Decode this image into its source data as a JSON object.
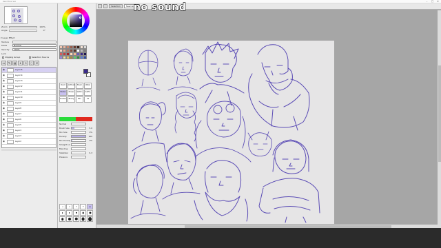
{
  "caption": "no sound",
  "titlebar": {
    "title": "PaintTool SAI"
  },
  "navigator": {
    "zoom_label": "Zoom",
    "zoom_value": "100%",
    "angle_label": "Angle",
    "angle_value": "0°"
  },
  "layer_panel": {
    "header": "▾ Layer Effect",
    "texture_label": "Texture",
    "effect_label": "Effect",
    "mode_label": "Mode",
    "mode_value": "Normal",
    "opacity_label": "Opacity",
    "opacity_value": "100%",
    "lock_label": "Lock",
    "clipping_label": "Clipping Group",
    "selection_source_label": "Selection Source",
    "layers": [
      {
        "name": "Layer15",
        "sub": "Normal\n100%",
        "selected": true
      },
      {
        "name": "Layer14",
        "sub": "Normal\n100%"
      },
      {
        "name": "Layer13",
        "sub": "Normal\n100%"
      },
      {
        "name": "Layer12",
        "sub": "Normal\n100%"
      },
      {
        "name": "Layer11",
        "sub": "Normal\n100%"
      },
      {
        "name": "Layer10",
        "sub": "Normal\n100%"
      },
      {
        "name": "Layer9",
        "sub": "Normal\n100%"
      },
      {
        "name": "Layer8",
        "sub": "Normal\n100%"
      },
      {
        "name": "Layer7",
        "sub": "Normal\n100%"
      },
      {
        "name": "Layer6",
        "sub": "Normal\n100%"
      },
      {
        "name": "Layer5",
        "sub": "Normal\n100%"
      },
      {
        "name": "Layer4",
        "sub": "Normal\n100%"
      },
      {
        "name": "Layer3",
        "sub": "Normal\n100%"
      },
      {
        "name": "Layer2",
        "sub": "Normal\n100%"
      }
    ]
  },
  "color_panel": {
    "swatches": [
      "#f2c9b5",
      "#e8b39c",
      "#c98670",
      "#9d5c4a",
      "#6b3b2f",
      "#3b211a",
      "#f5e3d6",
      "#d9d9d9",
      "#f7d6c7",
      "#e7a98e",
      "#b97a63",
      "#844f3f",
      "#522f26",
      "#ffffff",
      "#bfbfbf",
      "#7f7f7f",
      "#d75b5b",
      "#c93a3a",
      "#a02828",
      "#ffd9b8",
      "#f2b38d",
      "#6a5bb8",
      "#3a2a8a",
      "#1e1550",
      "#9a88e0",
      "#f1e2a6",
      "#e1c064",
      "#a88a3c",
      "#57d16d",
      "#2f8f47",
      "#5a7fd9",
      "#2d4ea8"
    ],
    "fg_color": "#3a2a8a",
    "bg_color": "#ffffff",
    "brushes": [
      {
        "name": "Pencil",
        "selected": false
      },
      {
        "name": "AirBrush",
        "selected": false
      },
      {
        "name": "Brush",
        "selected": false
      },
      {
        "name": "Water",
        "selected": false
      },
      {
        "name": "Marker",
        "selected": true
      },
      {
        "name": "Eraser",
        "selected": false
      },
      {
        "name": "SelPen",
        "selected": false
      },
      {
        "name": "SelErs",
        "selected": false
      },
      {
        "name": "Bucket",
        "selected": false
      },
      {
        "name": "Binary",
        "selected": false
      },
      {
        "name": "Blur",
        "selected": false
      },
      {
        "name": "Ink",
        "selected": false
      }
    ],
    "settings": [
      {
        "label": "Normal",
        "value": "",
        "fill": 0
      },
      {
        "label": "Brush Size",
        "value": "5.0",
        "fill": 0.2
      },
      {
        "label": "Min Size",
        "value": "0%",
        "fill": 0
      },
      {
        "label": "Density",
        "value": "100",
        "fill": 1
      },
      {
        "label": "Min Density",
        "value": "0%",
        "fill": 0.04
      },
      {
        "label": "Straight Line",
        "value": "",
        "fill": 0
      },
      {
        "label": "Blending",
        "value": "",
        "fill": 0
      },
      {
        "label": "Stabilizer",
        "value": "S-3",
        "fill": 0
      },
      {
        "label": "Pressure",
        "value": "",
        "fill": 0
      }
    ],
    "brush_sizes": [
      1,
      1.5,
      2,
      2.3,
      2.6,
      3,
      3.5,
      4,
      5,
      6,
      7,
      8,
      9,
      10,
      12
    ]
  },
  "canvas_window": {
    "tabs": [
      "",
      "",
      "Selection",
      "NewCanvas"
    ],
    "active_tab": 3
  }
}
